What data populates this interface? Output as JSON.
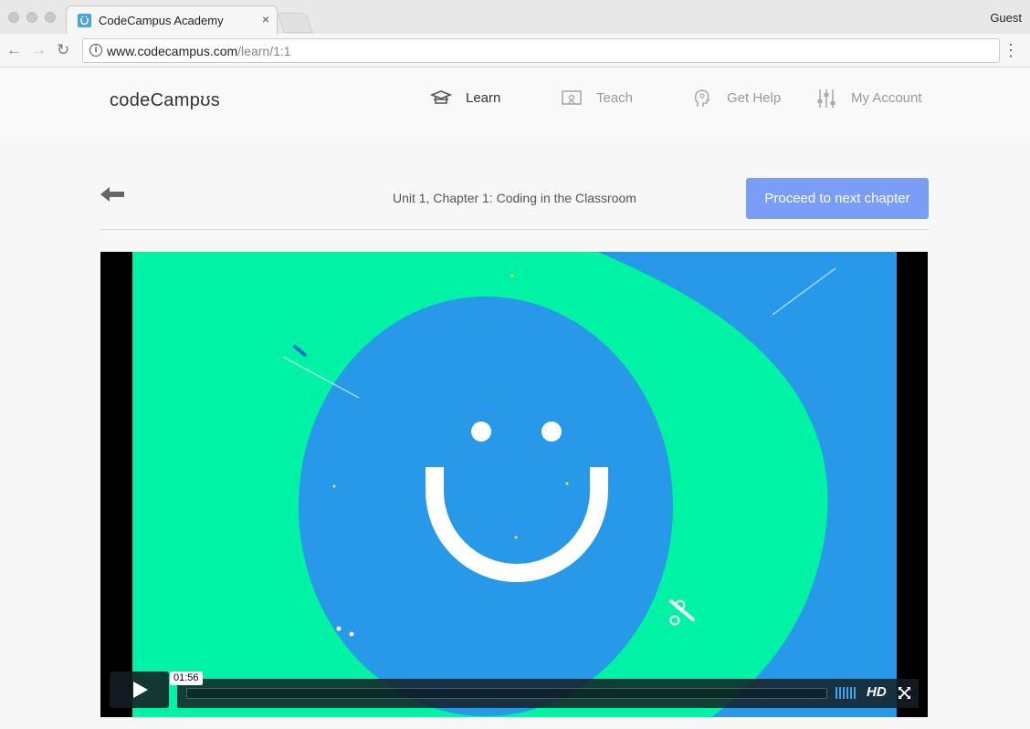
{
  "browser": {
    "tab_title": "CodeCampus Academy",
    "tab_close": "×",
    "profile": "Guest",
    "url_host": "www.codecampus.com",
    "url_path": "/learn/1:1",
    "menu": "⋮",
    "back": "←",
    "forward": "→",
    "reload": "↻"
  },
  "site": {
    "logo": "codeCampʊs",
    "nav": [
      {
        "label": "Learn",
        "icon": "graduation-cap-icon",
        "active": true
      },
      {
        "label": "Teach",
        "icon": "presentation-icon",
        "active": false
      },
      {
        "label": "Get Help",
        "icon": "head-icon",
        "active": false
      },
      {
        "label": "My Account",
        "icon": "sliders-icon",
        "active": false
      }
    ]
  },
  "lesson": {
    "title": "Unit 1, Chapter 1: Coding in the Classroom",
    "proceed_label": "Proceed to next chapter"
  },
  "video": {
    "time": "01:56",
    "hd_label": "HD",
    "progress": 0
  },
  "colors": {
    "accent": "#7a9df6",
    "video_green": "#00f2a5",
    "video_blue": "#2898e8"
  }
}
